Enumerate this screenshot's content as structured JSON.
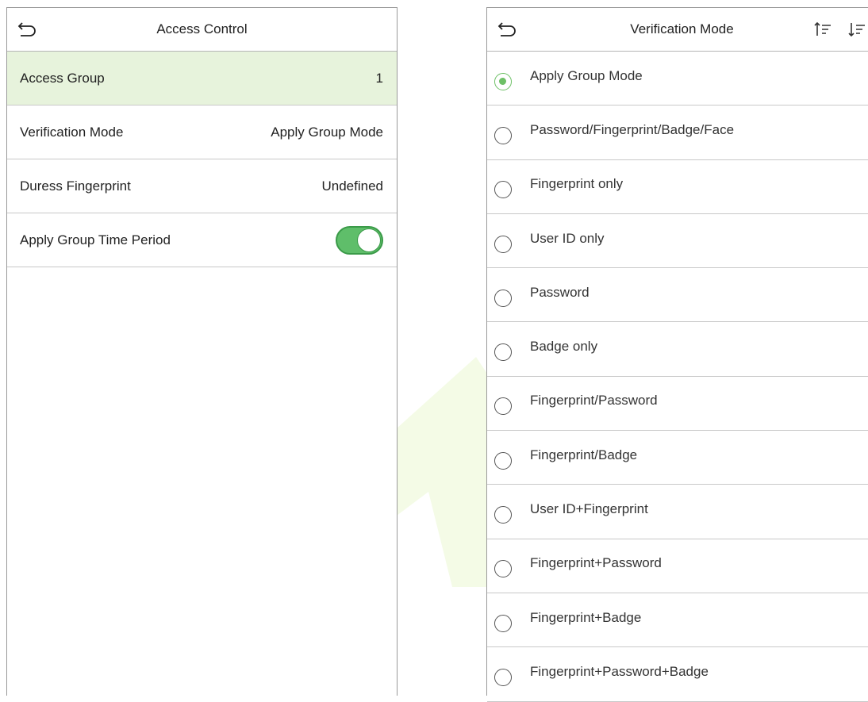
{
  "access_control": {
    "title": "Access Control",
    "rows": [
      {
        "label": "Access Group",
        "value": "1"
      },
      {
        "label": "Verification Mode",
        "value": "Apply Group Mode"
      },
      {
        "label": "Duress Fingerprint",
        "value": "Undefined"
      },
      {
        "label": "Apply Group Time Period",
        "toggle_on": true
      }
    ]
  },
  "verification_mode": {
    "title": "Verification Mode",
    "selected_index": 0,
    "options": [
      "Apply Group Mode",
      "Password/Fingerprint/Badge/Face",
      "Fingerprint only",
      "User ID only",
      "Password",
      "Badge only",
      "Fingerprint/Password",
      "Fingerprint/Badge",
      "User ID+Fingerprint",
      "Fingerprint+Password",
      "Fingerprint+Badge",
      "Fingerprint+Password+Badge"
    ]
  },
  "colors": {
    "selected_row": "#e7f3dc",
    "accent_green": "#5fbe6a",
    "radio_green": "#6dc066"
  },
  "icons": [
    "back-arrow-icon",
    "sort-ascending-icon",
    "sort-descending-icon",
    "toggle-switch"
  ]
}
